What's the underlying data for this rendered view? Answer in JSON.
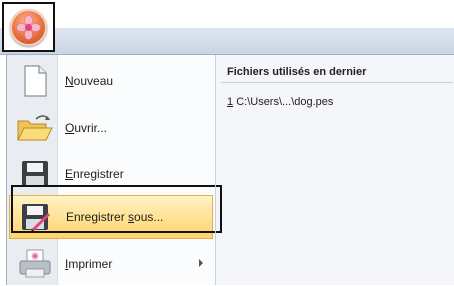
{
  "menu": {
    "items": [
      {
        "label_ul": "N",
        "label_rest": "ouveau"
      },
      {
        "label_ul": "O",
        "label_rest": "uvrir..."
      },
      {
        "label_ul": "E",
        "label_rest": "nregistrer"
      },
      {
        "label_pre": "Enregistrer ",
        "label_ul": "s",
        "label_rest": "ous..."
      },
      {
        "label_ul": "I",
        "label_rest": "mprimer"
      }
    ]
  },
  "recent": {
    "header": "Fichiers utilisés en dernier",
    "files": [
      {
        "index": "1",
        "path": "C:\\Users\\...\\dog.pes"
      }
    ]
  },
  "icons": {
    "app": "flower-app-icon",
    "new": "new-document-icon",
    "open": "open-folder-icon",
    "save": "save-disk-icon",
    "saveas": "save-as-icon",
    "print": "printer-icon"
  }
}
